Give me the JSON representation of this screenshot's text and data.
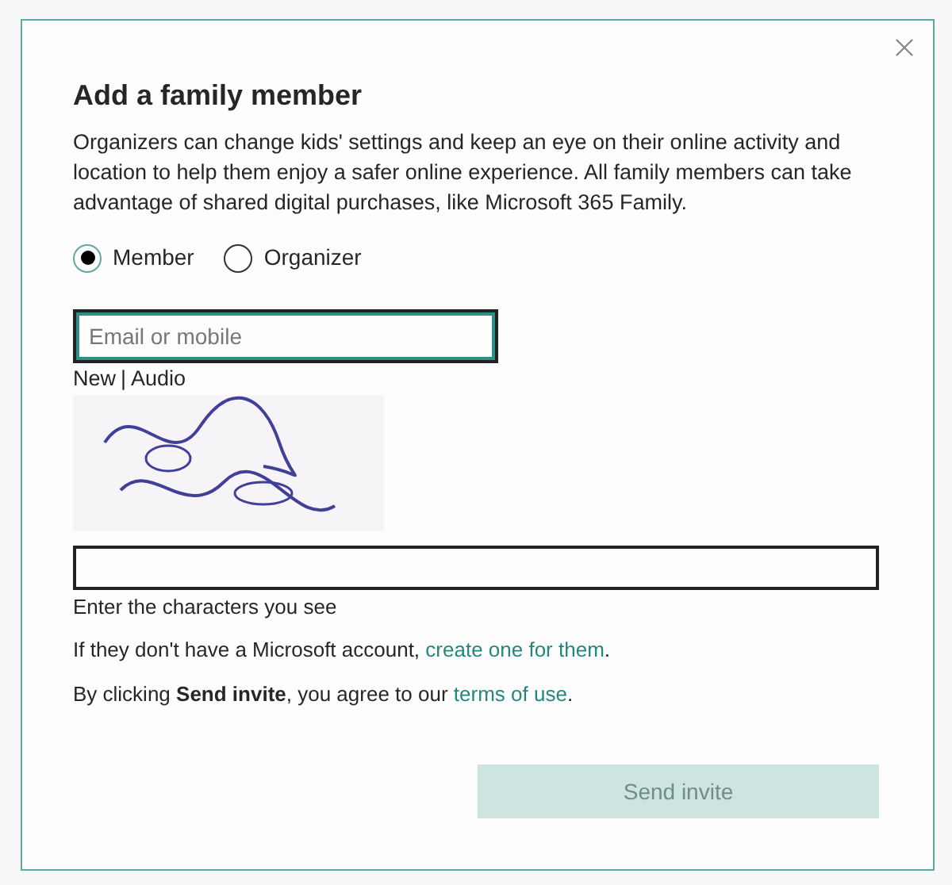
{
  "dialog": {
    "title": "Add a family member",
    "description": "Organizers can change kids' settings and keep an eye on their online activity and location to help them enjoy a safer online experience. All family members can take advantage of shared digital purchases, like Microsoft 365 Family.",
    "roles": [
      {
        "label": "Member",
        "selected": true
      },
      {
        "label": "Organizer",
        "selected": false
      }
    ],
    "email_field": {
      "placeholder": "Email or mobile",
      "focused": true
    },
    "captcha": {
      "links": [
        {
          "label": "New"
        },
        {
          "label": "Audio"
        }
      ],
      "separator": "|",
      "hint": "Enter the characters you see"
    },
    "account_note": {
      "text": "If they don't have a Microsoft account,",
      "link": "create one for them",
      "end": "."
    },
    "terms_note": {
      "text": "By clicking **Send invite**, you agree to our",
      "link": "terms of use",
      "end": "."
    },
    "send_button": {
      "label": "Send invite",
      "disabled": true
    }
  }
}
